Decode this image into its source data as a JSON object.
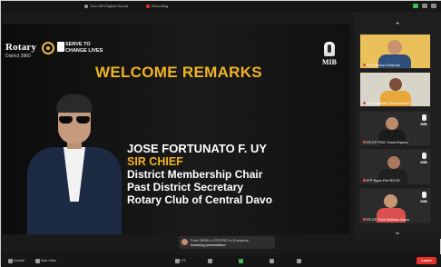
{
  "topbar": {
    "item1": "Turn Off Original Sound",
    "item2": "Recording"
  },
  "slide": {
    "rotary_name": "Rotary",
    "district": "District 3860",
    "serve_line1": "SERVE TO",
    "serve_line2": "CHANGE LIVES",
    "title": "WELCOME REMARKS",
    "mib_label": "MIB",
    "bio": {
      "name": "JOSE FORTUNATO F. UY",
      "nickname": "SIR CHIEF",
      "line1": "District Membership Chair",
      "line2": "Past District Secretary",
      "line3": "Rotary Club of Central Davo"
    }
  },
  "participants": [
    {
      "label": "PDG Anton Florendo"
    },
    {
      "label": "Pres Michael Chehelmeyer"
    },
    {
      "label": "RCCP PDG Yvard Espino"
    },
    {
      "label": "IPP Ryan Fiel RCCE"
    },
    {
      "label": "RCCE Pres Melissa Jason"
    }
  ],
  "chat": {
    "from": "From IRISH LOTEYRO to Everyone",
    "message": "Amazing presentation"
  },
  "toolbar": {
    "unmute": "Unmute",
    "video": "Start Video",
    "participants": "Participants",
    "participants_count": "172",
    "chat": "Chat",
    "share": "Share Screen",
    "record": "Record",
    "reactions": "Reactions",
    "leave": "Leave"
  },
  "colors": {
    "accent_gold": "#f0b323",
    "leave_red": "#e5322b"
  }
}
